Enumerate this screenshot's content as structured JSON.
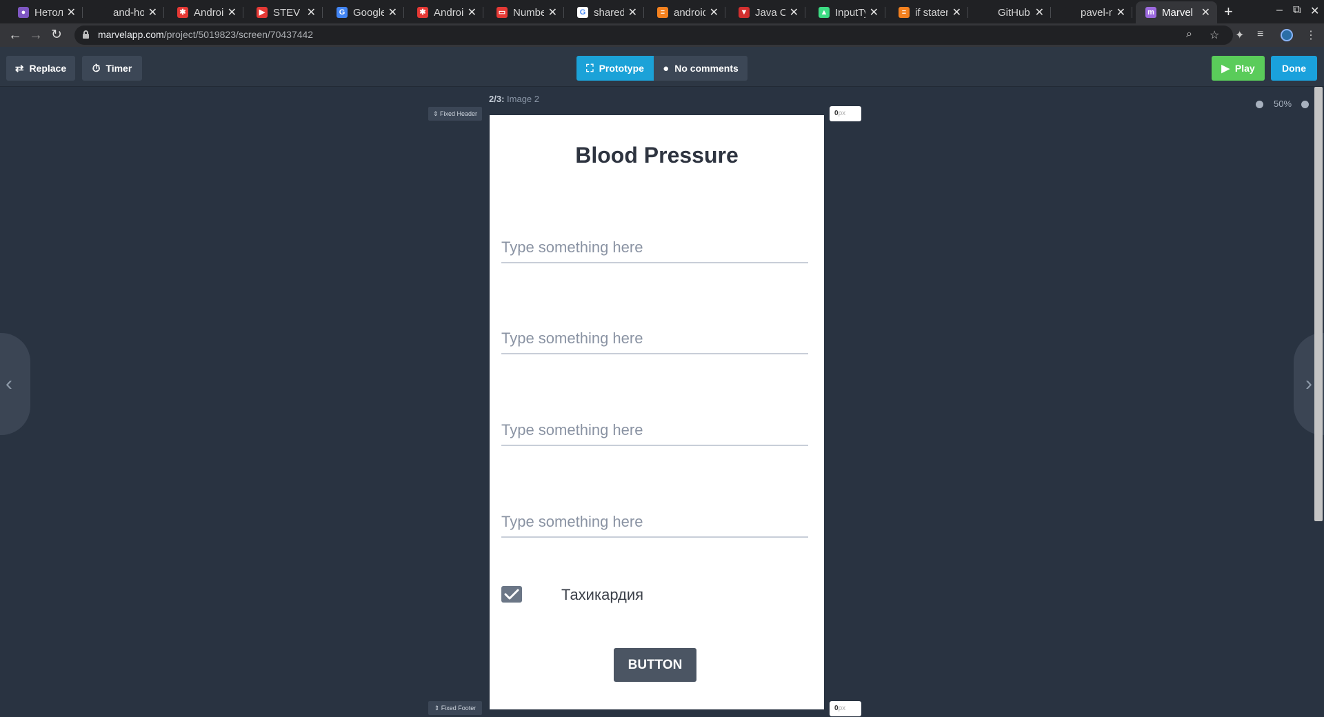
{
  "browser": {
    "tabs": [
      {
        "title": "Нетолог",
        "fav_color": "#7e57c2",
        "fav_glyph": "●"
      },
      {
        "title": "and-hom",
        "fav_color": "#202124",
        "fav_glyph": ""
      },
      {
        "title": "Android",
        "fav_color": "#e53935",
        "fav_glyph": "✱"
      },
      {
        "title": "STEV",
        "fav_color": "#e53935",
        "fav_glyph": "▶"
      },
      {
        "title": "Google",
        "fav_color": "#4285f4",
        "fav_glyph": "G"
      },
      {
        "title": "Android",
        "fav_color": "#e53935",
        "fav_glyph": "✱"
      },
      {
        "title": "NumberF",
        "fav_color": "#e53935",
        "fav_glyph": "▭"
      },
      {
        "title": "sharedp",
        "fav_color": "#ffffff",
        "fav_glyph": "G"
      },
      {
        "title": "android",
        "fav_color": "#f4811f",
        "fav_glyph": "≡"
      },
      {
        "title": "Java Co",
        "fav_color": "#d32f2f",
        "fav_glyph": "▼"
      },
      {
        "title": "InputTyp",
        "fav_color": "#3ddc84",
        "fav_glyph": "▲"
      },
      {
        "title": "if statem",
        "fav_color": "#f4811f",
        "fav_glyph": "≡"
      },
      {
        "title": "GitHub",
        "fav_color": "#202124",
        "fav_glyph": ""
      },
      {
        "title": "pavel-ma",
        "fav_color": "#202124",
        "fav_glyph": ""
      },
      {
        "title": "Marvel",
        "fav_color": "#9c6ade",
        "fav_glyph": "m"
      }
    ],
    "url_host": "marvelapp.com",
    "url_path": "/project/5019823/screen/70437442"
  },
  "toolbar": {
    "replace_label": "Replace",
    "timer_label": "Timer",
    "prototype_label": "Prototype",
    "comments_label": "No comments",
    "play_label": "Play",
    "done_label": "Done"
  },
  "canvas": {
    "screen_index": "2/3:",
    "screen_name": "Image 2",
    "fixed_header_label": "Fixed Header",
    "fixed_footer_label": "Fixed Footer",
    "header_px_value": "0",
    "footer_px_value": "0",
    "px_unit": "px",
    "zoom_level": "50%"
  },
  "screen": {
    "title": "Blood Pressure",
    "fields": [
      {
        "placeholder": "Type something here"
      },
      {
        "placeholder": "Type something here"
      },
      {
        "placeholder": "Type something here"
      },
      {
        "placeholder": "Type something here"
      }
    ],
    "checkbox_label": "Тахикардия",
    "checkbox_checked": true,
    "button_label": "BUTTON"
  },
  "colors": {
    "canvas_bg": "#293341",
    "toolbar_bg": "#2d3744",
    "prototype_blue": "#1ba2d8",
    "play_green": "#5acc5a",
    "done_blue": "#1aa1dc"
  }
}
